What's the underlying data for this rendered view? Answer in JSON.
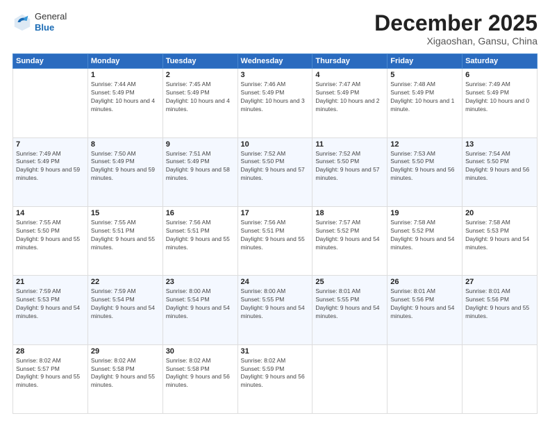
{
  "header": {
    "logo_line1": "General",
    "logo_line2": "Blue",
    "month": "December 2025",
    "location": "Xigaoshan, Gansu, China"
  },
  "days_of_week": [
    "Sunday",
    "Monday",
    "Tuesday",
    "Wednesday",
    "Thursday",
    "Friday",
    "Saturday"
  ],
  "weeks": [
    [
      {
        "day": "",
        "sunrise": "",
        "sunset": "",
        "daylight": ""
      },
      {
        "day": "1",
        "sunrise": "Sunrise: 7:44 AM",
        "sunset": "Sunset: 5:49 PM",
        "daylight": "Daylight: 10 hours and 4 minutes."
      },
      {
        "day": "2",
        "sunrise": "Sunrise: 7:45 AM",
        "sunset": "Sunset: 5:49 PM",
        "daylight": "Daylight: 10 hours and 4 minutes."
      },
      {
        "day": "3",
        "sunrise": "Sunrise: 7:46 AM",
        "sunset": "Sunset: 5:49 PM",
        "daylight": "Daylight: 10 hours and 3 minutes."
      },
      {
        "day": "4",
        "sunrise": "Sunrise: 7:47 AM",
        "sunset": "Sunset: 5:49 PM",
        "daylight": "Daylight: 10 hours and 2 minutes."
      },
      {
        "day": "5",
        "sunrise": "Sunrise: 7:48 AM",
        "sunset": "Sunset: 5:49 PM",
        "daylight": "Daylight: 10 hours and 1 minute."
      },
      {
        "day": "6",
        "sunrise": "Sunrise: 7:49 AM",
        "sunset": "Sunset: 5:49 PM",
        "daylight": "Daylight: 10 hours and 0 minutes."
      }
    ],
    [
      {
        "day": "7",
        "sunrise": "Sunrise: 7:49 AM",
        "sunset": "Sunset: 5:49 PM",
        "daylight": "Daylight: 9 hours and 59 minutes."
      },
      {
        "day": "8",
        "sunrise": "Sunrise: 7:50 AM",
        "sunset": "Sunset: 5:49 PM",
        "daylight": "Daylight: 9 hours and 59 minutes."
      },
      {
        "day": "9",
        "sunrise": "Sunrise: 7:51 AM",
        "sunset": "Sunset: 5:49 PM",
        "daylight": "Daylight: 9 hours and 58 minutes."
      },
      {
        "day": "10",
        "sunrise": "Sunrise: 7:52 AM",
        "sunset": "Sunset: 5:50 PM",
        "daylight": "Daylight: 9 hours and 57 minutes."
      },
      {
        "day": "11",
        "sunrise": "Sunrise: 7:52 AM",
        "sunset": "Sunset: 5:50 PM",
        "daylight": "Daylight: 9 hours and 57 minutes."
      },
      {
        "day": "12",
        "sunrise": "Sunrise: 7:53 AM",
        "sunset": "Sunset: 5:50 PM",
        "daylight": "Daylight: 9 hours and 56 minutes."
      },
      {
        "day": "13",
        "sunrise": "Sunrise: 7:54 AM",
        "sunset": "Sunset: 5:50 PM",
        "daylight": "Daylight: 9 hours and 56 minutes."
      }
    ],
    [
      {
        "day": "14",
        "sunrise": "Sunrise: 7:55 AM",
        "sunset": "Sunset: 5:50 PM",
        "daylight": "Daylight: 9 hours and 55 minutes."
      },
      {
        "day": "15",
        "sunrise": "Sunrise: 7:55 AM",
        "sunset": "Sunset: 5:51 PM",
        "daylight": "Daylight: 9 hours and 55 minutes."
      },
      {
        "day": "16",
        "sunrise": "Sunrise: 7:56 AM",
        "sunset": "Sunset: 5:51 PM",
        "daylight": "Daylight: 9 hours and 55 minutes."
      },
      {
        "day": "17",
        "sunrise": "Sunrise: 7:56 AM",
        "sunset": "Sunset: 5:51 PM",
        "daylight": "Daylight: 9 hours and 55 minutes."
      },
      {
        "day": "18",
        "sunrise": "Sunrise: 7:57 AM",
        "sunset": "Sunset: 5:52 PM",
        "daylight": "Daylight: 9 hours and 54 minutes."
      },
      {
        "day": "19",
        "sunrise": "Sunrise: 7:58 AM",
        "sunset": "Sunset: 5:52 PM",
        "daylight": "Daylight: 9 hours and 54 minutes."
      },
      {
        "day": "20",
        "sunrise": "Sunrise: 7:58 AM",
        "sunset": "Sunset: 5:53 PM",
        "daylight": "Daylight: 9 hours and 54 minutes."
      }
    ],
    [
      {
        "day": "21",
        "sunrise": "Sunrise: 7:59 AM",
        "sunset": "Sunset: 5:53 PM",
        "daylight": "Daylight: 9 hours and 54 minutes."
      },
      {
        "day": "22",
        "sunrise": "Sunrise: 7:59 AM",
        "sunset": "Sunset: 5:54 PM",
        "daylight": "Daylight: 9 hours and 54 minutes."
      },
      {
        "day": "23",
        "sunrise": "Sunrise: 8:00 AM",
        "sunset": "Sunset: 5:54 PM",
        "daylight": "Daylight: 9 hours and 54 minutes."
      },
      {
        "day": "24",
        "sunrise": "Sunrise: 8:00 AM",
        "sunset": "Sunset: 5:55 PM",
        "daylight": "Daylight: 9 hours and 54 minutes."
      },
      {
        "day": "25",
        "sunrise": "Sunrise: 8:01 AM",
        "sunset": "Sunset: 5:55 PM",
        "daylight": "Daylight: 9 hours and 54 minutes."
      },
      {
        "day": "26",
        "sunrise": "Sunrise: 8:01 AM",
        "sunset": "Sunset: 5:56 PM",
        "daylight": "Daylight: 9 hours and 54 minutes."
      },
      {
        "day": "27",
        "sunrise": "Sunrise: 8:01 AM",
        "sunset": "Sunset: 5:56 PM",
        "daylight": "Daylight: 9 hours and 55 minutes."
      }
    ],
    [
      {
        "day": "28",
        "sunrise": "Sunrise: 8:02 AM",
        "sunset": "Sunset: 5:57 PM",
        "daylight": "Daylight: 9 hours and 55 minutes."
      },
      {
        "day": "29",
        "sunrise": "Sunrise: 8:02 AM",
        "sunset": "Sunset: 5:58 PM",
        "daylight": "Daylight: 9 hours and 55 minutes."
      },
      {
        "day": "30",
        "sunrise": "Sunrise: 8:02 AM",
        "sunset": "Sunset: 5:58 PM",
        "daylight": "Daylight: 9 hours and 56 minutes."
      },
      {
        "day": "31",
        "sunrise": "Sunrise: 8:02 AM",
        "sunset": "Sunset: 5:59 PM",
        "daylight": "Daylight: 9 hours and 56 minutes."
      },
      {
        "day": "",
        "sunrise": "",
        "sunset": "",
        "daylight": ""
      },
      {
        "day": "",
        "sunrise": "",
        "sunset": "",
        "daylight": ""
      },
      {
        "day": "",
        "sunrise": "",
        "sunset": "",
        "daylight": ""
      }
    ]
  ]
}
